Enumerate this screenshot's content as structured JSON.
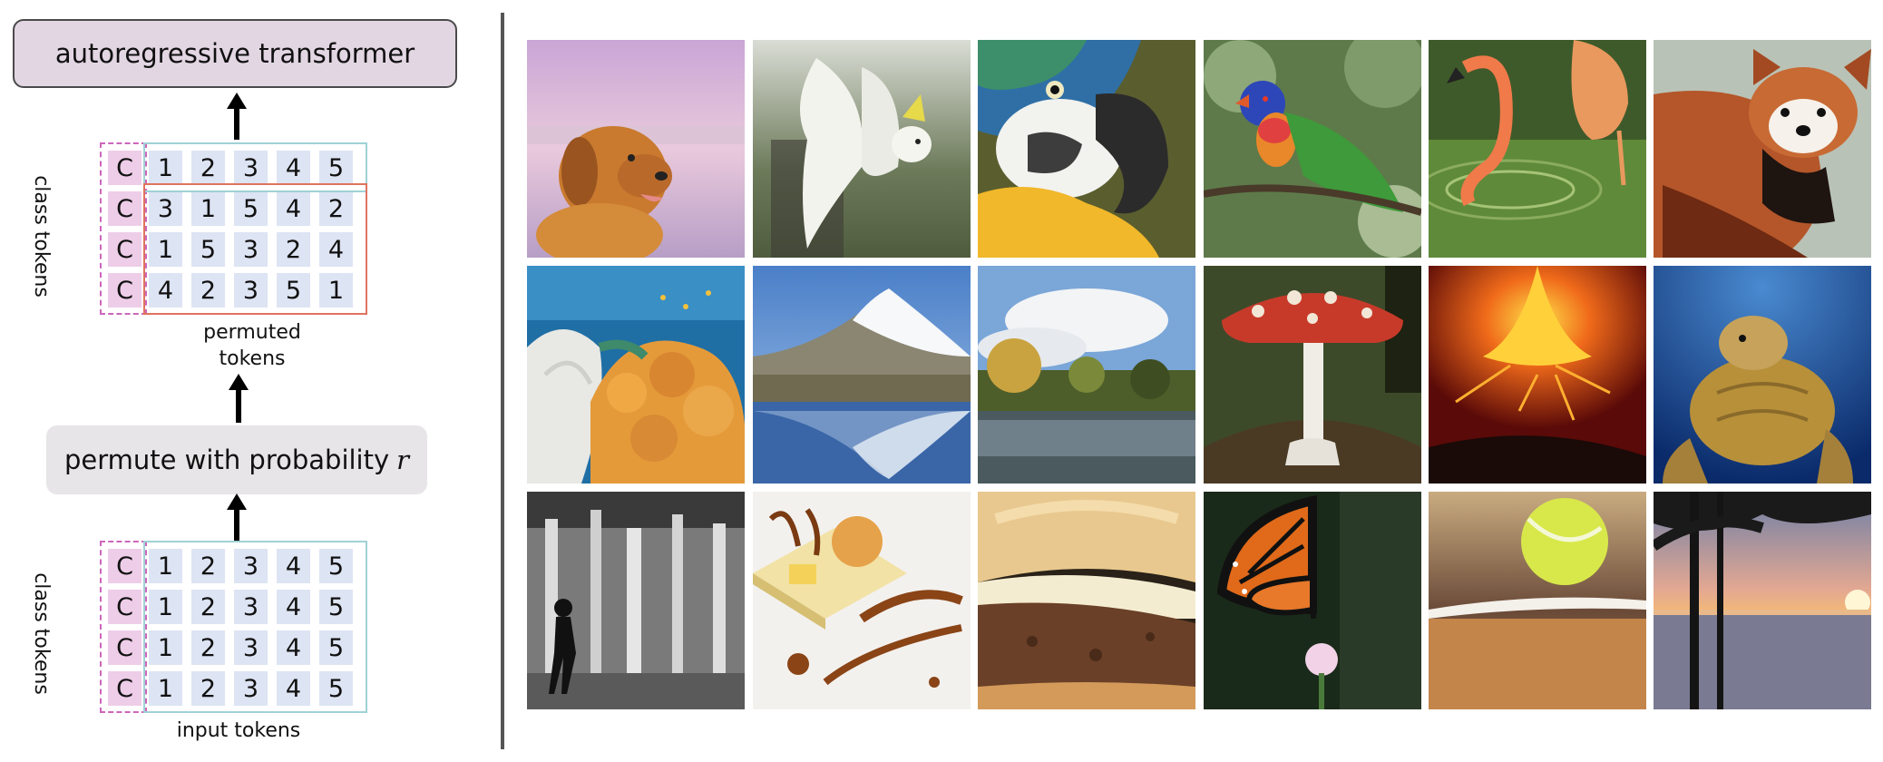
{
  "diagram": {
    "top_box": "autoregressive transformer",
    "permute_box_text": "permute with probability",
    "permute_symbol": "r",
    "class_tokens_label": "class tokens",
    "permuted_tokens_label_line1": "permuted",
    "permuted_tokens_label_line2": "tokens",
    "input_tokens_label": "input tokens",
    "class_token_char": "C",
    "top_grid": {
      "rows": [
        [
          "1",
          "2",
          "3",
          "4",
          "5"
        ],
        [
          "3",
          "1",
          "5",
          "4",
          "2"
        ],
        [
          "1",
          "5",
          "3",
          "2",
          "4"
        ],
        [
          "4",
          "2",
          "3",
          "5",
          "1"
        ]
      ]
    },
    "bottom_grid": {
      "rows": [
        [
          "1",
          "2",
          "3",
          "4",
          "5"
        ],
        [
          "1",
          "2",
          "3",
          "4",
          "5"
        ],
        [
          "1",
          "2",
          "3",
          "4",
          "5"
        ],
        [
          "1",
          "2",
          "3",
          "4",
          "5"
        ]
      ]
    }
  },
  "gallery": {
    "images": [
      "golden retriever",
      "cockatoo",
      "macaw",
      "lorikeet",
      "flamingo",
      "red panda",
      "coral reef",
      "snow mountain lake",
      "lakeside",
      "mushroom",
      "volcano",
      "sea turtle",
      "fountain",
      "dessert plate",
      "cheeseburger",
      "monarch butterfly",
      "tennis ball",
      "lake sunset"
    ]
  },
  "colors": {
    "transformer_fill": "#e3d6e3",
    "permute_fill": "#e7e5e7",
    "token_fill": "#dde4f3",
    "class_token_fill": "#eecde8",
    "class_dash": "#cc66bb",
    "input_outline": "#9fd2d6",
    "permuted_outline": "#e0735f"
  }
}
